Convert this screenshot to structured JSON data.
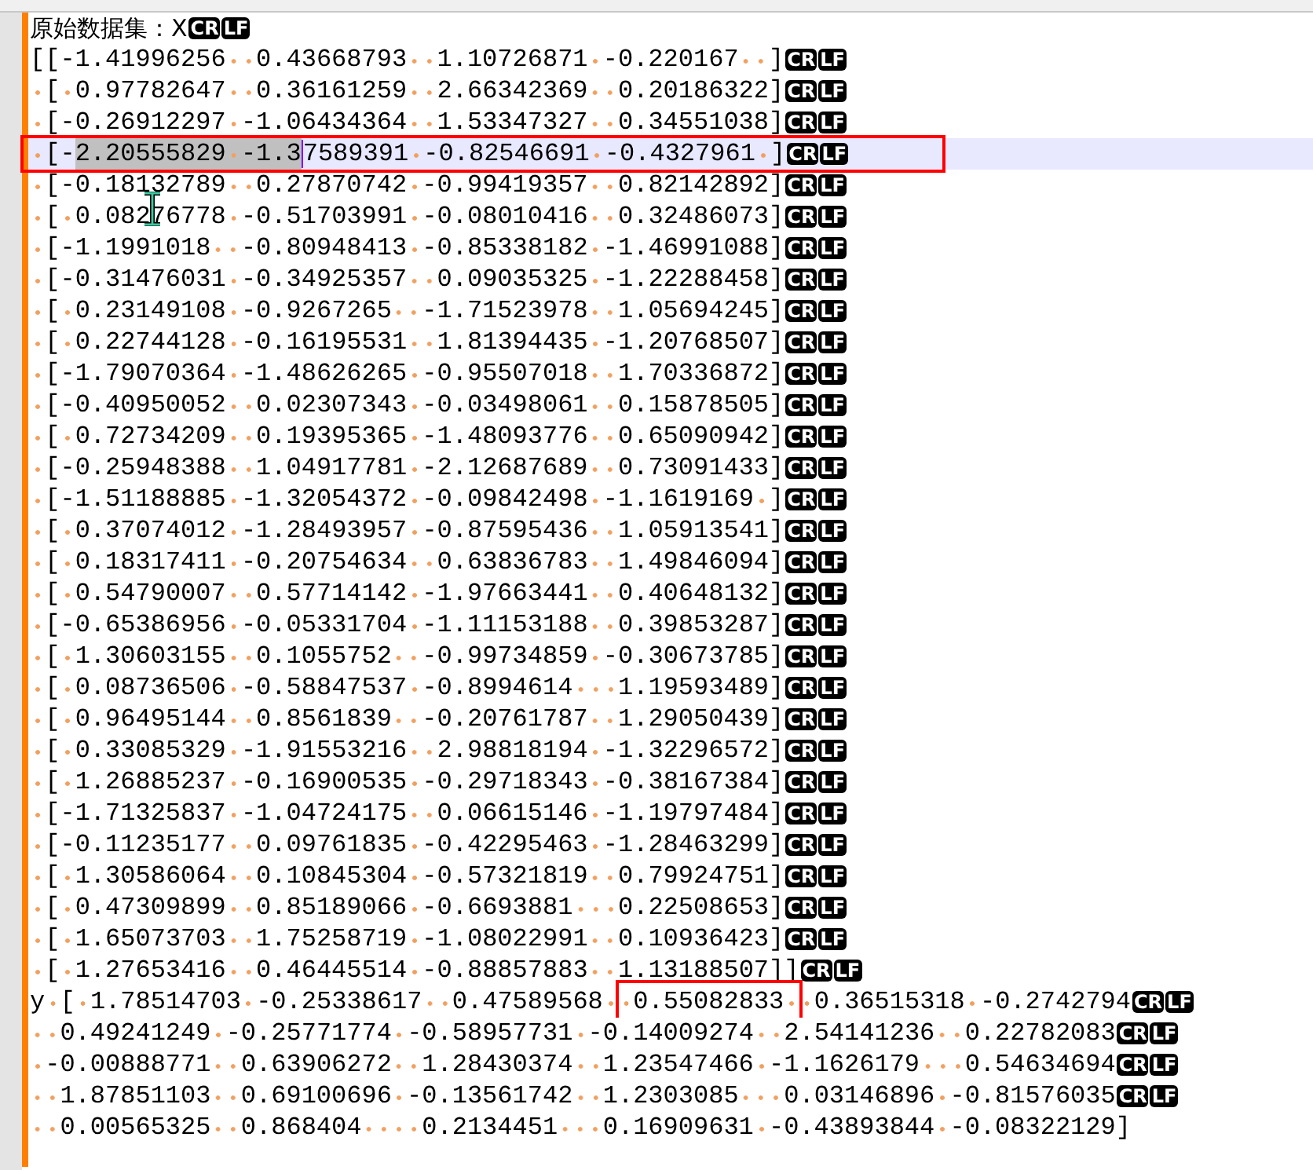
{
  "editor": {
    "lines": [
      {
        "kind": "heading",
        "current": false,
        "parts": [
          {
            "text": "原始数据集：X",
            "selected": false,
            "boxed": false
          }
        ],
        "eol": [
          "CR",
          "LF"
        ]
      },
      {
        "kind": "code",
        "current": false,
        "parts": [
          {
            "text": "[[-1.41996256  0.43668793  1.10726871 -0.220167  ]",
            "selected": false,
            "boxed": false
          }
        ],
        "eol": [
          "CR",
          "LF"
        ]
      },
      {
        "kind": "code",
        "current": false,
        "parts": [
          {
            "text": " [ 0.97782647  0.36161259  2.66342369  0.20186322]",
            "selected": false,
            "boxed": false
          }
        ],
        "eol": [
          "CR",
          "LF"
        ]
      },
      {
        "kind": "code",
        "current": false,
        "parts": [
          {
            "text": " [-0.26912297 -1.06434364  1.53347327  0.34551038]",
            "selected": false,
            "boxed": false
          }
        ],
        "eol": [
          "CR",
          "LF"
        ]
      },
      {
        "kind": "code",
        "current": true,
        "boxed": true,
        "parts": [
          {
            "text": " [-",
            "selected": false,
            "boxed": false
          },
          {
            "text": "2.20555829 -1.3",
            "selected": true,
            "boxed": false
          },
          {
            "text": "7589391 -0.82546691 -0.4327961 ]",
            "selected": false,
            "boxed": false
          }
        ],
        "eol": [
          "CR",
          "LF"
        ]
      },
      {
        "kind": "code",
        "current": false,
        "parts": [
          {
            "text": " [-0.18132789  0.27870742 -0.99419357  0.82142892]",
            "selected": false,
            "boxed": false
          }
        ],
        "eol": [
          "CR",
          "LF"
        ]
      },
      {
        "kind": "code",
        "current": false,
        "parts": [
          {
            "text": " [ 0.08276778 -0.51703991 -0.08010416  0.32486073]",
            "selected": false,
            "boxed": false
          }
        ],
        "eol": [
          "CR",
          "LF"
        ]
      },
      {
        "kind": "code",
        "current": false,
        "parts": [
          {
            "text": " [-1.1991018  -0.80948413 -0.85338182 -1.46991088]",
            "selected": false,
            "boxed": false
          }
        ],
        "eol": [
          "CR",
          "LF"
        ]
      },
      {
        "kind": "code",
        "current": false,
        "parts": [
          {
            "text": " [-0.31476031 -0.34925357  0.09035325 -1.22288458]",
            "selected": false,
            "boxed": false
          }
        ],
        "eol": [
          "CR",
          "LF"
        ]
      },
      {
        "kind": "code",
        "current": false,
        "parts": [
          {
            "text": " [ 0.23149108 -0.9267265  -1.71523978  1.05694245]",
            "selected": false,
            "boxed": false
          }
        ],
        "eol": [
          "CR",
          "LF"
        ]
      },
      {
        "kind": "code",
        "current": false,
        "parts": [
          {
            "text": " [ 0.22744128 -0.16195531  1.81394435 -1.20768507]",
            "selected": false,
            "boxed": false
          }
        ],
        "eol": [
          "CR",
          "LF"
        ]
      },
      {
        "kind": "code",
        "current": false,
        "parts": [
          {
            "text": " [-1.79070364 -1.48626265 -0.95507018  1.70336872]",
            "selected": false,
            "boxed": false
          }
        ],
        "eol": [
          "CR",
          "LF"
        ]
      },
      {
        "kind": "code",
        "current": false,
        "parts": [
          {
            "text": " [-0.40950052  0.02307343 -0.03498061  0.15878505]",
            "selected": false,
            "boxed": false
          }
        ],
        "eol": [
          "CR",
          "LF"
        ]
      },
      {
        "kind": "code",
        "current": false,
        "parts": [
          {
            "text": " [ 0.72734209  0.19395365 -1.48093776  0.65090942]",
            "selected": false,
            "boxed": false
          }
        ],
        "eol": [
          "CR",
          "LF"
        ]
      },
      {
        "kind": "code",
        "current": false,
        "parts": [
          {
            "text": " [-0.25948388  1.04917781 -2.12687689  0.73091433]",
            "selected": false,
            "boxed": false
          }
        ],
        "eol": [
          "CR",
          "LF"
        ]
      },
      {
        "kind": "code",
        "current": false,
        "parts": [
          {
            "text": " [-1.51188885 -1.32054372 -0.09842498 -1.1619169 ]",
            "selected": false,
            "boxed": false
          }
        ],
        "eol": [
          "CR",
          "LF"
        ]
      },
      {
        "kind": "code",
        "current": false,
        "parts": [
          {
            "text": " [ 0.37074012 -1.28493957 -0.87595436  1.05913541]",
            "selected": false,
            "boxed": false
          }
        ],
        "eol": [
          "CR",
          "LF"
        ]
      },
      {
        "kind": "code",
        "current": false,
        "parts": [
          {
            "text": " [ 0.18317411 -0.20754634  0.63836783  1.49846094]",
            "selected": false,
            "boxed": false
          }
        ],
        "eol": [
          "CR",
          "LF"
        ]
      },
      {
        "kind": "code",
        "current": false,
        "parts": [
          {
            "text": " [ 0.54790007  0.57714142 -1.97663441  0.40648132]",
            "selected": false,
            "boxed": false
          }
        ],
        "eol": [
          "CR",
          "LF"
        ]
      },
      {
        "kind": "code",
        "current": false,
        "parts": [
          {
            "text": " [-0.65386956 -0.05331704 -1.11153188  0.39853287]",
            "selected": false,
            "boxed": false
          }
        ],
        "eol": [
          "CR",
          "LF"
        ]
      },
      {
        "kind": "code",
        "current": false,
        "parts": [
          {
            "text": " [ 1.30603155  0.1055752  -0.99734859 -0.30673785]",
            "selected": false,
            "boxed": false
          }
        ],
        "eol": [
          "CR",
          "LF"
        ]
      },
      {
        "kind": "code",
        "current": false,
        "parts": [
          {
            "text": " [ 0.08736506 -0.58847537 -0.8994614   1.19593489]",
            "selected": false,
            "boxed": false
          }
        ],
        "eol": [
          "CR",
          "LF"
        ]
      },
      {
        "kind": "code",
        "current": false,
        "parts": [
          {
            "text": " [ 0.96495144  0.8561839  -0.20761787  1.29050439]",
            "selected": false,
            "boxed": false
          }
        ],
        "eol": [
          "CR",
          "LF"
        ]
      },
      {
        "kind": "code",
        "current": false,
        "parts": [
          {
            "text": " [ 0.33085329 -1.91553216  2.98818194 -1.32296572]",
            "selected": false,
            "boxed": false
          }
        ],
        "eol": [
          "CR",
          "LF"
        ]
      },
      {
        "kind": "code",
        "current": false,
        "parts": [
          {
            "text": " [ 1.26885237 -0.16900535 -0.29718343 -0.38167384]",
            "selected": false,
            "boxed": false
          }
        ],
        "eol": [
          "CR",
          "LF"
        ]
      },
      {
        "kind": "code",
        "current": false,
        "parts": [
          {
            "text": " [-1.71325837 -1.04724175  0.06615146 -1.19797484]",
            "selected": false,
            "boxed": false
          }
        ],
        "eol": [
          "CR",
          "LF"
        ]
      },
      {
        "kind": "code",
        "current": false,
        "parts": [
          {
            "text": " [-0.11235177  0.09761835 -0.42295463 -1.28463299]",
            "selected": false,
            "boxed": false
          }
        ],
        "eol": [
          "CR",
          "LF"
        ]
      },
      {
        "kind": "code",
        "current": false,
        "parts": [
          {
            "text": " [ 1.30586064  0.10845304 -0.57321819  0.79924751]",
            "selected": false,
            "boxed": false
          }
        ],
        "eol": [
          "CR",
          "LF"
        ]
      },
      {
        "kind": "code",
        "current": false,
        "parts": [
          {
            "text": " [ 0.47309899  0.85189066 -0.6693881   0.22508653]",
            "selected": false,
            "boxed": false
          }
        ],
        "eol": [
          "CR",
          "LF"
        ]
      },
      {
        "kind": "code",
        "current": false,
        "parts": [
          {
            "text": " [ 1.65073703  1.75258719 -1.08022991  0.10936423]",
            "selected": false,
            "boxed": false
          }
        ],
        "eol": [
          "CR",
          "LF"
        ]
      },
      {
        "kind": "code",
        "current": false,
        "parts": [
          {
            "text": " [ 1.27653416  0.46445514 -0.88857883  1.13188507]]",
            "selected": false,
            "boxed": false
          }
        ],
        "eol": [
          "CR",
          "LF"
        ]
      },
      {
        "kind": "code",
        "current": false,
        "parts": [
          {
            "text": "y [ 1.78514703 -0.25338617  0.47589568 ",
            "selected": false,
            "boxed": false
          },
          {
            "text": " 0.55082833 ",
            "selected": false,
            "boxed": true
          },
          {
            "text": " 0.36515318 -0.2742794",
            "selected": false,
            "boxed": false
          }
        ],
        "eol": [
          "CR",
          "LF"
        ]
      },
      {
        "kind": "code",
        "current": false,
        "parts": [
          {
            "text": "  0.49241249 -0.25771774 -0.58957731 -0.14009274  2.54141236  0.22782083",
            "selected": false,
            "boxed": false
          }
        ],
        "eol": [
          "CR",
          "LF"
        ]
      },
      {
        "kind": "code",
        "current": false,
        "parts": [
          {
            "text": " -0.00888771  0.63906272  1.28430374  1.23547466 -1.1626179   0.54634694",
            "selected": false,
            "boxed": false
          }
        ],
        "eol": [
          "CR",
          "LF"
        ]
      },
      {
        "kind": "code",
        "current": false,
        "parts": [
          {
            "text": "  1.87851103  0.69100696 -0.13561742  1.2303085   0.03146896 -0.81576035",
            "selected": false,
            "boxed": false
          }
        ],
        "eol": [
          "CR",
          "LF"
        ]
      },
      {
        "kind": "code",
        "current": false,
        "parts": [
          {
            "text": "  0.00565325  0.868404    0.2134451   0.16909631 -0.43893844 -0.08322129]",
            "selected": false,
            "boxed": false
          }
        ]
      }
    ]
  }
}
